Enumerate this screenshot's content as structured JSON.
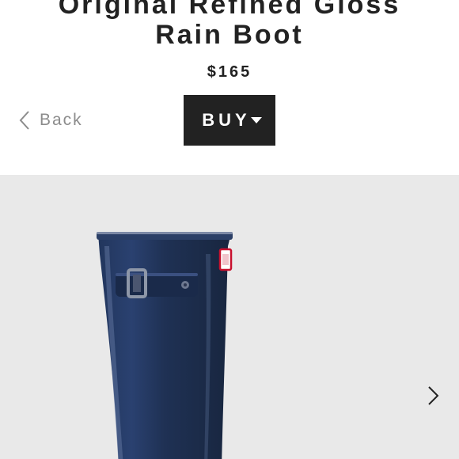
{
  "product": {
    "title_line1": "Original Refined Gloss",
    "title_line2": "Rain Boot",
    "price": "$165"
  },
  "nav": {
    "back_label": "Back",
    "back_icon": "chevron-left-icon"
  },
  "buy_button": {
    "label": "BUY",
    "icon": "caret-down-icon"
  },
  "gallery": {
    "next_icon": "chevron-right-icon",
    "image": "navy gloss rain boot",
    "boot_color": "#1f3154",
    "background_color": "#e9e9e9"
  }
}
